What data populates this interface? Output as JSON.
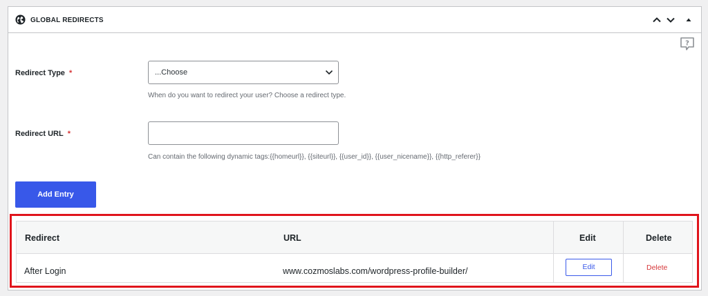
{
  "panel": {
    "title": "GLOBAL REDIRECTS"
  },
  "form": {
    "redirect_type": {
      "label": "Redirect Type",
      "required_mark": "*",
      "selected": "...Choose",
      "description": "When do you want to redirect your user? Choose a redirect type."
    },
    "redirect_url": {
      "label": "Redirect URL",
      "required_mark": "*",
      "value": "",
      "description": "Can contain the following dynamic tags:{{homeurl}}, {{siteurl}}, {{user_id}}, {{user_nicename}}, {{http_referer}}"
    },
    "add_button_label": "Add Entry"
  },
  "table": {
    "headers": {
      "redirect": "Redirect",
      "url": "URL",
      "edit": "Edit",
      "delete": "Delete"
    },
    "rows": [
      {
        "redirect": "After Login",
        "url": "www.cozmoslabs.com/wordpress-profile-builder/",
        "edit_label": "Edit",
        "delete_label": "Delete"
      }
    ]
  },
  "colors": {
    "primary": "#3858e9",
    "danger": "#d63638",
    "highlight": "#e0141b"
  },
  "icons": {
    "header": "globe-icon",
    "collapse_up": "chevron-up-icon",
    "collapse_down": "chevron-down-icon",
    "toggle": "triangle-up-icon",
    "help": "help-bubble-icon"
  }
}
